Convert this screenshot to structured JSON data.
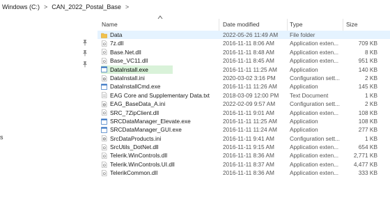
{
  "breadcrumb": {
    "items": [
      "Windows (C:)",
      "CAN_2022_Postal_Base"
    ],
    "separator": ">"
  },
  "nav": {
    "partial_char": "s"
  },
  "columns": {
    "name": "Name",
    "date": "Date modified",
    "type": "Type",
    "size": "Size"
  },
  "colors": {
    "selected_bg": "#e5f3ff",
    "rename_bg": "#d9f2d9",
    "folder": "#f1c24c"
  },
  "files": [
    {
      "name": "Data",
      "date": "2022-05-26 11:49 AM",
      "type": "File folder",
      "size": "",
      "icon": "folder-icon"
    },
    {
      "name": "7z.dll",
      "date": "2016-11-11 8:06 AM",
      "type": "Application exten...",
      "size": "709 KB",
      "icon": "dll-file-icon"
    },
    {
      "name": "Base.Net.dll",
      "date": "2016-11-11 8:48 AM",
      "type": "Application exten...",
      "size": "8 KB",
      "icon": "dll-file-icon"
    },
    {
      "name": "Base_VC11.dll",
      "date": "2016-11-11 8:45 AM",
      "type": "Application exten...",
      "size": "951 KB",
      "icon": "dll-file-icon"
    },
    {
      "name": "DataInstall.exe",
      "date": "2016-11-11 11:25 AM",
      "type": "Application",
      "size": "140 KB",
      "icon": "exe-file-icon"
    },
    {
      "name": "DataInstall.ini",
      "date": "2020-03-02 3:16 PM",
      "type": "Configuration sett...",
      "size": "2 KB",
      "icon": "ini-file-icon"
    },
    {
      "name": "DataInstallCmd.exe",
      "date": "2016-11-11 11:26 AM",
      "type": "Application",
      "size": "145 KB",
      "icon": "exe-file-icon"
    },
    {
      "name": "EAG Core and Supplementary Data.txt",
      "date": "2018-03-09 12:00 PM",
      "type": "Text Document",
      "size": "1 KB",
      "icon": "txt-file-icon"
    },
    {
      "name": "EAG_BaseData_A.ini",
      "date": "2022-02-09 9:57 AM",
      "type": "Configuration sett...",
      "size": "2 KB",
      "icon": "ini-file-icon"
    },
    {
      "name": "SRC_7ZipClient.dll",
      "date": "2016-11-11 9:01 AM",
      "type": "Application exten...",
      "size": "108 KB",
      "icon": "dll-file-icon"
    },
    {
      "name": "SRCDataManager_Elevate.exe",
      "date": "2016-11-11 11:25 AM",
      "type": "Application",
      "size": "108 KB",
      "icon": "exe-file-icon"
    },
    {
      "name": "SRCDataManager_GUI.exe",
      "date": "2016-11-11 11:24 AM",
      "type": "Application",
      "size": "277 KB",
      "icon": "exe-file-icon"
    },
    {
      "name": "SrcDataProducts.ini",
      "date": "2016-11-11 9:41 AM",
      "type": "Configuration sett...",
      "size": "1 KB",
      "icon": "ini-file-icon"
    },
    {
      "name": "SrcUtils_DotNet.dll",
      "date": "2016-11-11 9:15 AM",
      "type": "Application exten...",
      "size": "654 KB",
      "icon": "dll-file-icon"
    },
    {
      "name": "Telerik.WinControls.dll",
      "date": "2016-11-11 8:36 AM",
      "type": "Application exten...",
      "size": "2,771 KB",
      "icon": "dll-file-icon"
    },
    {
      "name": "Telerik.WinControls.UI.dll",
      "date": "2016-11-11 8:37 AM",
      "type": "Application exten...",
      "size": "4,477 KB",
      "icon": "dll-file-icon"
    },
    {
      "name": "TelerikCommon.dll",
      "date": "2016-11-11 8:36 AM",
      "type": "Application exten...",
      "size": "333 KB",
      "icon": "dll-file-icon"
    }
  ],
  "state": {
    "selected_index": 0,
    "rename_index": 4
  }
}
